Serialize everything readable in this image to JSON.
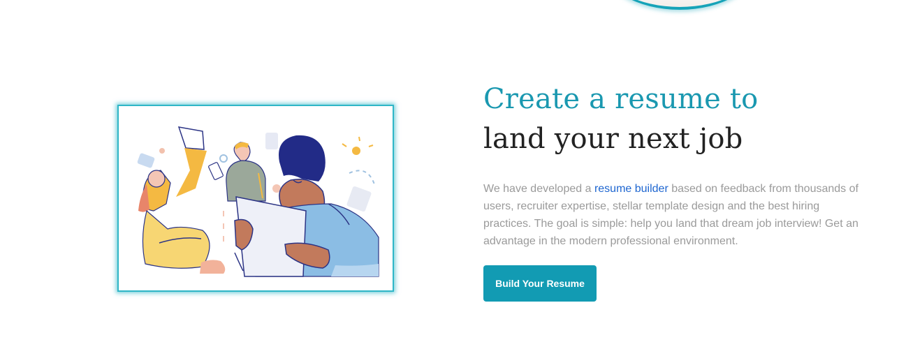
{
  "hero": {
    "headline_line1": "Create a resume to",
    "headline_line2": "land your next job",
    "description_before": "We have developed a ",
    "description_link": "resume builder",
    "description_after": " based on feedback from thousands of users, recruiter expertise, stellar template design and the best hiring practices. The goal is simple: help you land that dream job interview! Get an advantage in the modern professional environment.",
    "cta_label": "Build Your Resume"
  },
  "colors": {
    "accent": "#129bb3",
    "headline_accent": "#1a98b0",
    "headline_dark": "#222222",
    "body_text": "#9a9a9a",
    "link": "#1e66d0"
  },
  "icons": {
    "illustration": "people-working-on-resumes-illustration"
  }
}
